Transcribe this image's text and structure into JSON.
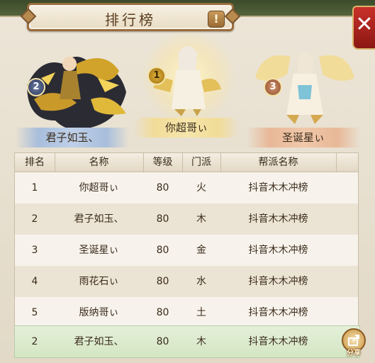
{
  "title": "排行榜",
  "info_label": "!",
  "close_label": "✕",
  "podium": [
    {
      "rank": "1",
      "name": "你超哥ぃ"
    },
    {
      "rank": "2",
      "name": "君子如玉、"
    },
    {
      "rank": "3",
      "name": "圣诞星ぃ"
    }
  ],
  "table": {
    "headers": {
      "rank": "排名",
      "name": "名称",
      "level": "等级",
      "sect": "门派",
      "guild": "帮派名称"
    },
    "rows": [
      {
        "rank": "1",
        "name": "你超哥ぃ",
        "level": "80",
        "sect": "火",
        "guild": "抖音木木冲榜"
      },
      {
        "rank": "2",
        "name": "君子如玉、",
        "level": "80",
        "sect": "木",
        "guild": "抖音木木冲榜"
      },
      {
        "rank": "3",
        "name": "圣诞星ぃ",
        "level": "80",
        "sect": "金",
        "guild": "抖音木木冲榜"
      },
      {
        "rank": "4",
        "name": "雨花石ぃ",
        "level": "80",
        "sect": "水",
        "guild": "抖音木木冲榜"
      },
      {
        "rank": "5",
        "name": "版纳哥ぃ",
        "level": "80",
        "sect": "土",
        "guild": "抖音木木冲榜"
      }
    ]
  },
  "my_row": {
    "rank": "2",
    "name": "君子如玉、",
    "level": "80",
    "sect": "木",
    "guild": "抖音木木冲榜"
  },
  "share_label": "分享",
  "colors": {
    "accent_red": "#c9302a",
    "gold": "#e2b63c",
    "my_row_bg": "#dcebcf"
  }
}
